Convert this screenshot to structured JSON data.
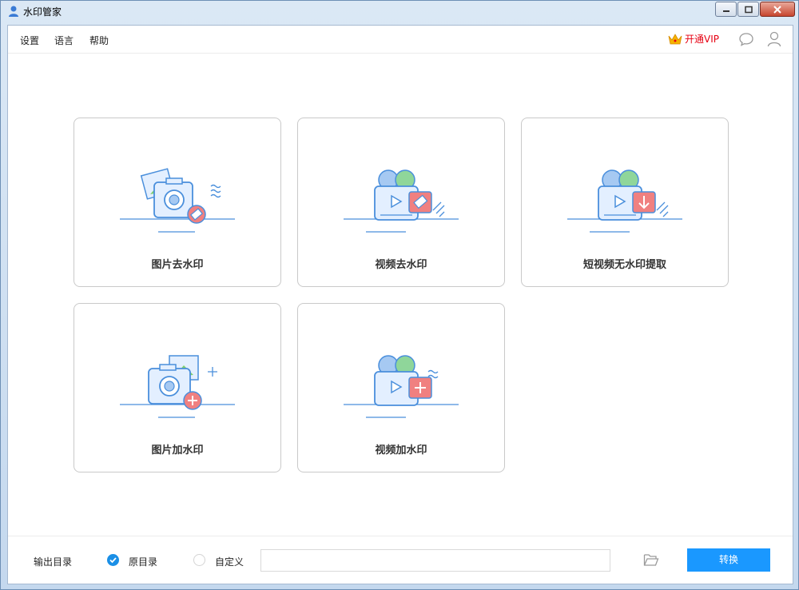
{
  "window": {
    "title": "水印管家"
  },
  "menu": {
    "items": [
      "设置",
      "语言",
      "帮助"
    ],
    "vip_label": "开通VIP"
  },
  "cards": [
    {
      "label": "图片去水印"
    },
    {
      "label": "视频去水印"
    },
    {
      "label": "短视频无水印提取"
    },
    {
      "label": "图片加水印"
    },
    {
      "label": "视频加水印"
    }
  ],
  "bottom": {
    "output_label": "输出目录",
    "option_original": "原目录",
    "option_custom": "自定义",
    "path_value": "",
    "convert_label": "转换"
  },
  "colors": {
    "accent": "#1a98ff",
    "vip": "#e60012",
    "illus_blue": "#4a8fdc",
    "illus_red": "#f08080"
  }
}
